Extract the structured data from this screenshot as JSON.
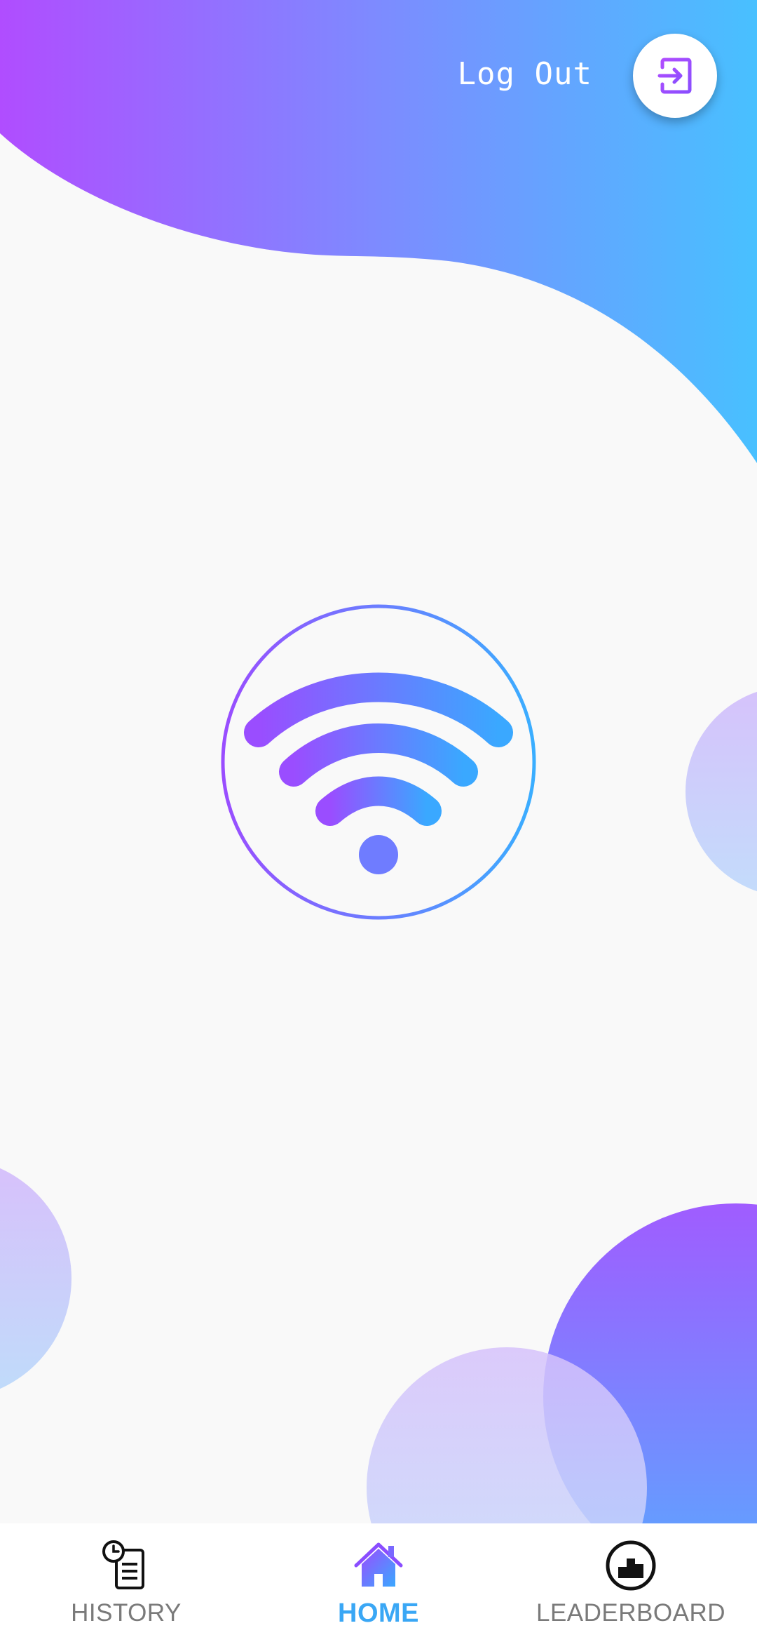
{
  "header": {
    "logout_label": "Log Out",
    "logout_icon": "logout-arrow-icon"
  },
  "main": {
    "center_icon": "wifi-icon"
  },
  "bottom_nav": {
    "items": [
      {
        "label": "HISTORY",
        "icon": "history-clipboard-icon",
        "active": false
      },
      {
        "label": "HOME",
        "icon": "home-icon",
        "active": true
      },
      {
        "label": "LEADERBOARD",
        "icon": "leaderboard-podium-icon",
        "active": false
      }
    ]
  },
  "colors": {
    "gradient_start": "#b04dff",
    "gradient_end": "#42c2ff",
    "background": "#f9f9f9",
    "active_nav": "#3aa7f5",
    "inactive_nav": "#7a7a7a"
  }
}
